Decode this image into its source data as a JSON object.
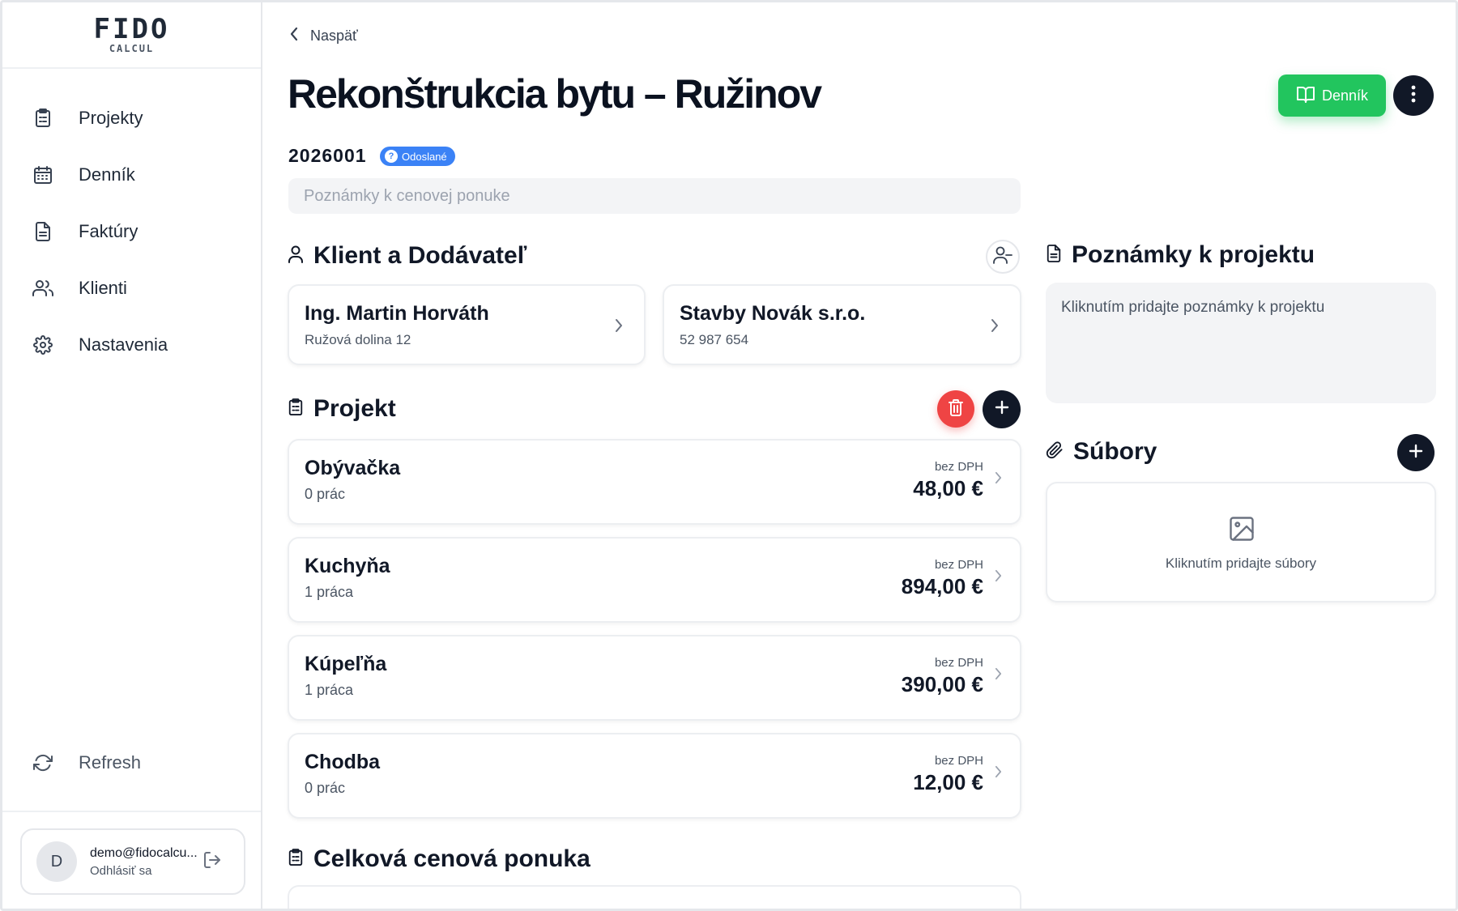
{
  "sidebar": {
    "logo": {
      "main": "FIDO",
      "sub": "CALCUL"
    },
    "items": [
      {
        "label": "Projekty",
        "icon": "clipboard-icon"
      },
      {
        "label": "Denník",
        "icon": "calendar-icon"
      },
      {
        "label": "Faktúry",
        "icon": "document-icon"
      },
      {
        "label": "Klienti",
        "icon": "users-icon"
      },
      {
        "label": "Nastavenia",
        "icon": "gear-icon"
      }
    ],
    "refresh": {
      "label": "Refresh",
      "icon": "refresh-icon"
    },
    "user": {
      "initial": "D",
      "email": "demo@fidocalcu...",
      "logout": "Odhlásiť sa"
    }
  },
  "header": {
    "back_label": "Naspäť",
    "title": "Rekonštrukcia bytu – Ružinov",
    "dennik_button": "Denník",
    "project_number": "2026001",
    "status_badge": "Odoslané",
    "notes_placeholder": "Poznámky k cenovej ponuke"
  },
  "client_section": {
    "title": "Klient a Dodávateľ",
    "client": {
      "name": "Ing. Martin Horváth",
      "detail": "Ružová dolina 12"
    },
    "supplier": {
      "name": "Stavby Novák s.r.o.",
      "detail": "52 987 654"
    }
  },
  "project_section": {
    "title": "Projekt",
    "rooms": [
      {
        "name": "Obývačka",
        "count": "0 prác",
        "price_label": "bez DPH",
        "price": "48,00 €"
      },
      {
        "name": "Kuchyňa",
        "count": "1 práca",
        "price_label": "bez DPH",
        "price": "894,00 €"
      },
      {
        "name": "Kúpeľňa",
        "count": "1 práca",
        "price_label": "bez DPH",
        "price": "390,00 €"
      },
      {
        "name": "Chodba",
        "count": "0 prác",
        "price_label": "bez DPH",
        "price": "12,00 €"
      }
    ]
  },
  "total_section": {
    "title": "Celková cenová ponuka"
  },
  "project_notes": {
    "title": "Poznámky k projektu",
    "placeholder": "Kliknutím pridajte poznámky k projektu"
  },
  "files": {
    "title": "Súbory",
    "placeholder": "Kliknutím pridajte súbory"
  },
  "colors": {
    "accent_green": "#22c55e",
    "danger_red": "#ef4444",
    "badge_blue": "#3b82f6",
    "dark": "#111827"
  }
}
